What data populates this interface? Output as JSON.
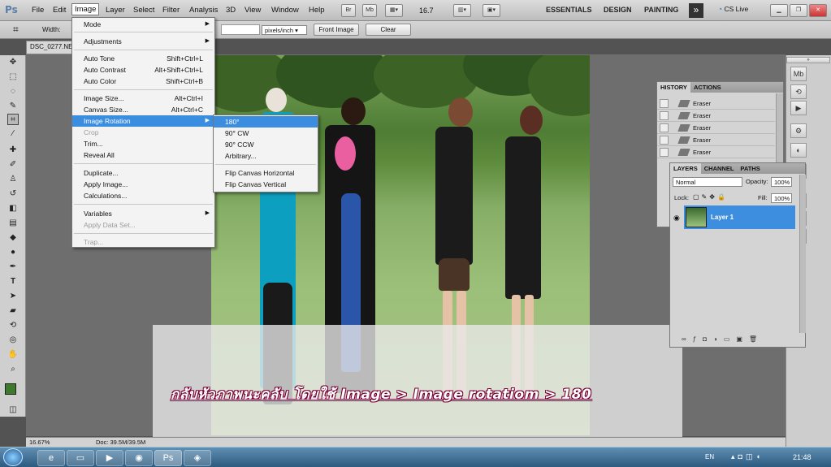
{
  "app": {
    "logo": "Ps"
  },
  "menubar": {
    "items": [
      "File",
      "Edit",
      "Image",
      "Layer",
      "Select",
      "Filter",
      "Analysis",
      "3D",
      "View",
      "Window",
      "Help"
    ],
    "buttons": [
      "Br",
      "Mb"
    ],
    "zoom": "16.7",
    "workspaces": [
      "ESSENTIALS",
      "DESIGN",
      "PAINTING"
    ],
    "more": "»",
    "cslive": "CS Live"
  },
  "options": {
    "width_label": "Width:",
    "units": "pixels/inch",
    "front_image": "Front Image",
    "clear": "Clear"
  },
  "document": {
    "tab": "DSC_0277.NE",
    "zoom_status": "16.67%",
    "doc_status": "Doc: 39.5M/39.5M"
  },
  "image_menu": {
    "items": [
      {
        "label": "Mode",
        "shortcut": "",
        "submenu": true,
        "disabled": false
      },
      {
        "label": "Adjustments",
        "shortcut": "",
        "submenu": true,
        "disabled": false
      },
      {
        "label": "Auto Tone",
        "shortcut": "Shift+Ctrl+L",
        "submenu": false,
        "disabled": false
      },
      {
        "label": "Auto Contrast",
        "shortcut": "Alt+Shift+Ctrl+L",
        "submenu": false,
        "disabled": false
      },
      {
        "label": "Auto Color",
        "shortcut": "Shift+Ctrl+B",
        "submenu": false,
        "disabled": false
      },
      {
        "label": "Image Size...",
        "shortcut": "Alt+Ctrl+I",
        "submenu": false,
        "disabled": false
      },
      {
        "label": "Canvas Size...",
        "shortcut": "Alt+Ctrl+C",
        "submenu": false,
        "disabled": false
      },
      {
        "label": "Image Rotation",
        "shortcut": "",
        "submenu": true,
        "disabled": false
      },
      {
        "label": "Crop",
        "shortcut": "",
        "submenu": false,
        "disabled": true
      },
      {
        "label": "Trim...",
        "shortcut": "",
        "submenu": false,
        "disabled": false
      },
      {
        "label": "Reveal All",
        "shortcut": "",
        "submenu": false,
        "disabled": false
      },
      {
        "label": "Duplicate...",
        "shortcut": "",
        "submenu": false,
        "disabled": false
      },
      {
        "label": "Apply Image...",
        "shortcut": "",
        "submenu": false,
        "disabled": false
      },
      {
        "label": "Calculations...",
        "shortcut": "",
        "submenu": false,
        "disabled": false
      },
      {
        "label": "Variables",
        "shortcut": "",
        "submenu": true,
        "disabled": false
      },
      {
        "label": "Apply Data Set...",
        "shortcut": "",
        "submenu": false,
        "disabled": true
      },
      {
        "label": "Trap...",
        "shortcut": "",
        "submenu": false,
        "disabled": true
      }
    ]
  },
  "rotation_submenu": {
    "items": [
      "180°",
      "90° CW",
      "90° CCW",
      "Arbitrary...",
      "Flip Canvas Horizontal",
      "Flip Canvas Vertical"
    ]
  },
  "history": {
    "tabs": [
      "HISTORY",
      "ACTIONS"
    ],
    "steps": [
      "Eraser",
      "Eraser",
      "Eraser",
      "Eraser",
      "Eraser"
    ]
  },
  "layers": {
    "tabs": [
      "LAYERS",
      "CHANNEL",
      "PATHS"
    ],
    "blend": "Normal",
    "opacity_label": "Opacity:",
    "opacity": "100%",
    "lock_label": "Lock:",
    "fill_label": "Fill:",
    "fill": "100%",
    "layer_name": "Layer 1"
  },
  "caption": "กลับหัวภาพนะคลับ โดยใช้ Image > Image rotatiom > 180",
  "taskbar": {
    "lang": "EN",
    "time": "21:48"
  }
}
